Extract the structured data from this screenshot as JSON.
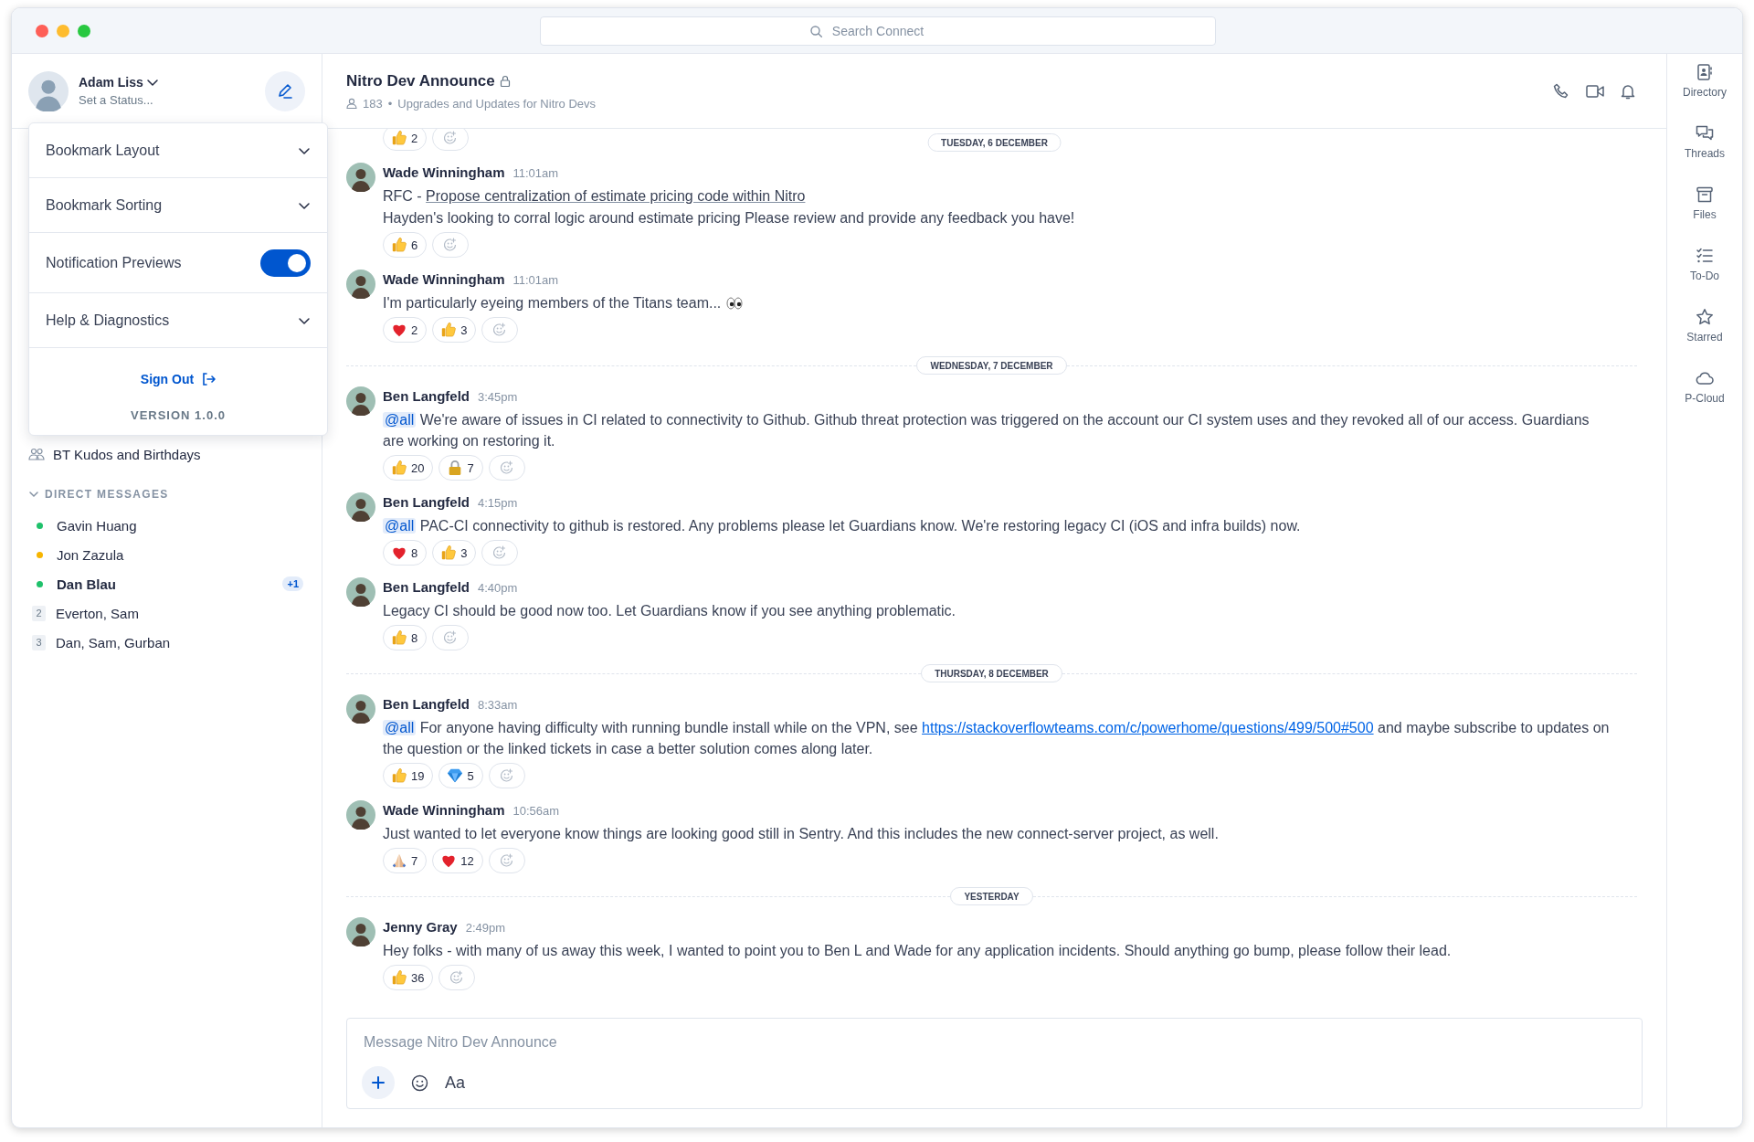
{
  "window": {
    "search": {
      "placeholder": "Search Connect"
    }
  },
  "user": {
    "name": "Adam Liss",
    "status": "Set a Status..."
  },
  "settings_menu": {
    "items": [
      {
        "kind": "dropdown",
        "label": "Bookmark Layout"
      },
      {
        "kind": "dropdown",
        "label": "Bookmark Sorting"
      },
      {
        "kind": "toggle",
        "label": "Notification Previews",
        "on": true
      },
      {
        "kind": "dropdown",
        "label": "Help & Diagnostics"
      }
    ],
    "sign_out": "Sign Out",
    "version": "VERSION 1.0.0"
  },
  "sidebar": {
    "channels": [
      {
        "kind": "group",
        "name": "BT Kudos and Birthdays"
      }
    ],
    "direct_messages": {
      "title": "DIRECT MESSAGES",
      "expanded": true,
      "items": [
        {
          "kind": "person",
          "name": "Gavin Huang",
          "color": "#1fc16b",
          "unread": false
        },
        {
          "kind": "person",
          "name": "Jon Zazula",
          "color": "#f7b500",
          "unread": false
        },
        {
          "kind": "person",
          "name": "Dan Blau",
          "color": "#1fc16b",
          "unread": true,
          "badge": "+1"
        },
        {
          "kind": "group",
          "name": "Everton, Sam",
          "count": "2",
          "unread": false
        },
        {
          "kind": "group",
          "name": "Dan, Sam, Gurban",
          "count": "3",
          "unread": false
        }
      ]
    }
  },
  "channel": {
    "title": "Nitro Dev Announce",
    "private": true,
    "members": "183",
    "separator": "•",
    "description": "Upgrades and Updates for Nitro Devs"
  },
  "feed": {
    "sticky_date": "TUESDAY, 6 DECEMBER",
    "items": [
      {
        "kind": "reactions",
        "reactions": [
          {
            "kind": "thumbs_up",
            "count": "2"
          }
        ]
      },
      {
        "kind": "message",
        "author": "Wade Winningham",
        "time": "11:01am",
        "paragraphs": [
          [
            {
              "kind": "text",
              "text": "RFC - "
            },
            {
              "kind": "link",
              "text": "Propose centralization of estimate pricing code within Nitro"
            }
          ],
          [
            {
              "kind": "text",
              "text": "Hayden's looking to corral logic around estimate pricing Please review and provide any feedback you have!"
            }
          ]
        ],
        "reactions": [
          {
            "kind": "thumbs_up",
            "count": "6"
          }
        ]
      },
      {
        "kind": "message",
        "author": "Wade Winningham",
        "time": "11:01am",
        "paragraphs": [
          [
            {
              "kind": "text",
              "text": "I'm particularly eyeing members of the Titans team..."
            },
            {
              "kind": "eyes"
            }
          ]
        ],
        "reactions": [
          {
            "kind": "heart",
            "count": "2"
          },
          {
            "kind": "thumbs_up",
            "count": "3"
          }
        ]
      },
      {
        "kind": "date",
        "label": "WEDNESDAY, 7 DECEMBER"
      },
      {
        "kind": "message",
        "author": "Ben Langfeld",
        "time": "3:45pm",
        "paragraphs": [
          [
            {
              "kind": "mention",
              "text": "@all"
            },
            {
              "kind": "text",
              "text": " We're aware of issues in CI related to connectivity to Github. Github threat protection was triggered on the account our CI system uses and they revoked all of our access. Guardians are working on restoring it."
            }
          ]
        ],
        "reactions": [
          {
            "kind": "thumbs_up",
            "count": "20"
          },
          {
            "kind": "lock",
            "count": "7"
          }
        ]
      },
      {
        "kind": "message",
        "author": "Ben Langfeld",
        "time": "4:15pm",
        "paragraphs": [
          [
            {
              "kind": "mention",
              "text": "@all"
            },
            {
              "kind": "text",
              "text": " PAC-CI connectivity to github is restored. Any problems please let Guardians know. We're restoring legacy CI (iOS and infra builds) now."
            }
          ]
        ],
        "reactions": [
          {
            "kind": "heart",
            "count": "8"
          },
          {
            "kind": "thumbs_up",
            "count": "3"
          }
        ]
      },
      {
        "kind": "message",
        "author": "Ben Langfeld",
        "time": "4:40pm",
        "paragraphs": [
          [
            {
              "kind": "text",
              "text": "Legacy CI should be good now too. Let Guardians know if you see anything problematic."
            }
          ]
        ],
        "reactions": [
          {
            "kind": "thumbs_up",
            "count": "8"
          }
        ]
      },
      {
        "kind": "date",
        "label": "THURSDAY, 8 DECEMBER"
      },
      {
        "kind": "message",
        "author": "Ben Langfeld",
        "time": "8:33am",
        "paragraphs": [
          [
            {
              "kind": "mention",
              "text": "@all"
            },
            {
              "kind": "text",
              "text": " For anyone having difficulty with running bundle install while on the VPN, see "
            },
            {
              "kind": "url",
              "text": "https://stackoverflowteams.com/c/powerhome/questions/499/500#500"
            },
            {
              "kind": "text",
              "text": " and maybe subscribe to updates on the question or the linked tickets in case a better solution comes along later."
            }
          ]
        ],
        "reactions": [
          {
            "kind": "thumbs_up",
            "count": "19"
          },
          {
            "kind": "gem",
            "count": "5"
          }
        ]
      },
      {
        "kind": "message",
        "author": "Wade Winningham",
        "time": "10:56am",
        "paragraphs": [
          [
            {
              "kind": "text",
              "text": "Just wanted to let everyone know things are looking good still in Sentry. And this includes the new connect-server project, as well."
            }
          ]
        ],
        "reactions": [
          {
            "kind": "pray",
            "count": "7"
          },
          {
            "kind": "heart",
            "count": "12"
          }
        ]
      },
      {
        "kind": "date",
        "label": "YESTERDAY"
      },
      {
        "kind": "message",
        "author": "Jenny Gray",
        "time": "2:49pm",
        "paragraphs": [
          [
            {
              "kind": "text",
              "text": "Hey folks - with many of us away this week, I wanted to point you to Ben L and Wade for any application incidents. Should anything go bump, please follow their lead."
            }
          ]
        ],
        "reactions": [
          {
            "kind": "thumbs_up",
            "count": "36"
          }
        ]
      }
    ]
  },
  "composer": {
    "placeholder": "Message Nitro Dev Announce",
    "format_button": "Aa"
  },
  "rail": [
    {
      "kind": "directory",
      "label": "Directory"
    },
    {
      "kind": "threads",
      "label": "Threads"
    },
    {
      "kind": "files",
      "label": "Files"
    },
    {
      "kind": "todo",
      "label": "To-Do"
    },
    {
      "kind": "starred",
      "label": "Starred"
    },
    {
      "kind": "cloud",
      "label": "P-Cloud"
    }
  ]
}
